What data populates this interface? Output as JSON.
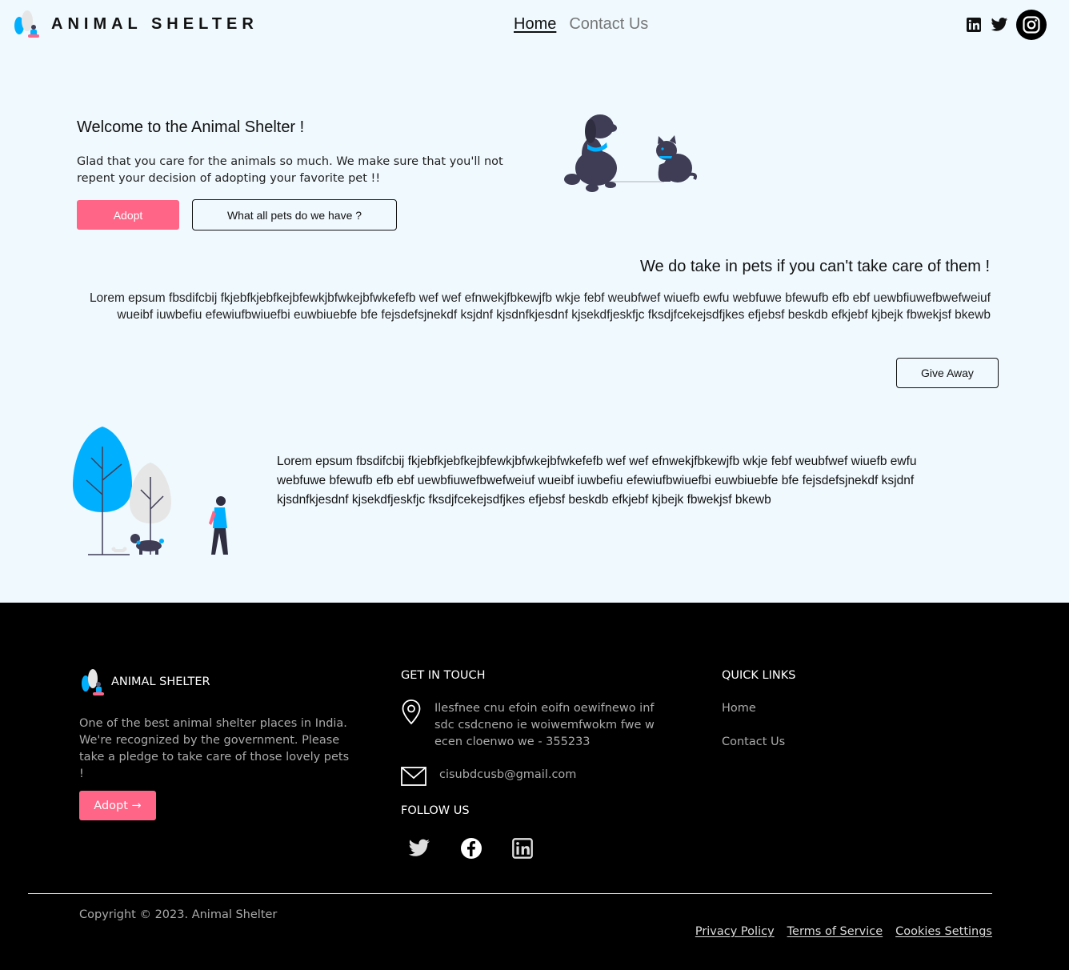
{
  "nav": {
    "brand": "ANIMAL SHELTER",
    "links": [
      "Home",
      "Contact Us"
    ],
    "social_icons": [
      "linkedin-icon",
      "twitter-icon",
      "instagram-icon"
    ]
  },
  "hero": {
    "title": "Welcome to the Animal Shelter !",
    "description": "Glad that you care for the animals so much. We make sure that you'll not repent your decision of adopting your favorite pet !!",
    "adopt_label": "Adopt",
    "pets_label": "What all pets do we have ?"
  },
  "giveaway": {
    "title": "We do take in pets if you can't take care of them !",
    "description": "Lorem epsum fbsdifcbij fkjebfkjebfkejbfewkjbfwkejbfwkefefb wef wef efnwekjfbkewjfb wkje febf weubfwef wiuefb ewfu webfuwe bfewufb efb ebf uewbfiuwefbwefweiuf wueibf iuwbefiu efewiufbwiuefbi euwbiuebfe bfe fejsdefsjnekdf ksjdnf kjsdnfkjesdnf kjsekdfjeskfjc fksdjfcekejsdfjkes efjebsf beskdb efkjebf kjbejk fbwekjsf bkewb",
    "button_label": "Give Away"
  },
  "walk": {
    "description": "Lorem epsum fbsdifcbij fkjebfkjebfkejbfewkjbfwkejbfwkefefb wef wef efnwekjfbkewjfb wkje febf weubfwef wiuefb ewfu webfuwe bfewufb efb ebf uewbfiuwefbwefweiuf wueibf iuwbefiu efewiufbwiuefbi euwbiuebfe bfe fejsdefsjnekdf ksjdnf kjsdnfkjesdnf kjsekdfjeskfjc fksdjfcekejsdfjkes efjebsf beskdb efkjebf kjbejk fbwekjsf bkewb"
  },
  "footer": {
    "brand": "ANIMAL SHELTER",
    "about": "One of the best animal shelter places in India. We're recognized by the government. Please take a pledge to take care of those lovely pets !",
    "adopt_label": "Adopt →",
    "touch_heading": "GET IN TOUCH",
    "address": "Ilesfnee cnu efoin eoifn oewifnewo inf sdc csdcneno ie woiwemfwokm fwe w ecen cloenwo we - 355233",
    "email": "cisubdcusb@gmail.com",
    "follow_heading": "FOLLOW US",
    "follow_icons": [
      "twitter-icon",
      "facebook-icon",
      "linkedin-icon"
    ],
    "quick_heading": "QUICK LINKS",
    "quick_links": [
      "Home",
      "Contact Us"
    ],
    "copyright": "Copyright © 2023. Animal Shelter",
    "legal_links": [
      "Privacy Policy",
      "Terms of Service",
      "Cookies Settings"
    ]
  },
  "colors": {
    "page_background": "#f0f9fe",
    "accent_pink": "#ff6587",
    "accent_blue": "#00b0ff",
    "footer_background": "#000000",
    "illustration_dark": "#3f3d56"
  }
}
